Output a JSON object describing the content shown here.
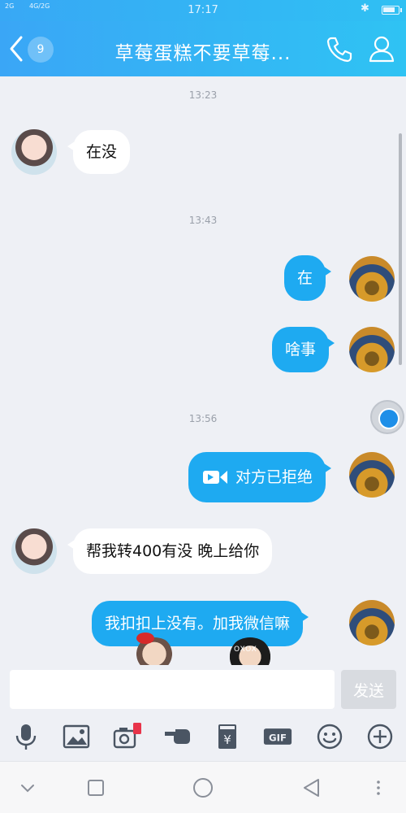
{
  "status_bar": {
    "signal_1": "2G",
    "signal_2": "4G/2G",
    "time": "17:17",
    "bluetooth_icon": "bluetooth-icon",
    "battery_icon": "battery-icon"
  },
  "header": {
    "back_icon": "chevron-left-icon",
    "unread_count": "9",
    "title": "草莓蛋糕不要草莓...",
    "phone_icon": "phone-icon",
    "profile_icon": "person-icon",
    "colors": {
      "gradient_start": "#3aa6f6",
      "gradient_end": "#2fc3f3"
    }
  },
  "chat": {
    "timestamps": [
      "13:23",
      "13:43",
      "13:56"
    ],
    "messages": [
      {
        "from": "other",
        "text": "在没"
      },
      {
        "from": "me",
        "text": "在"
      },
      {
        "from": "me",
        "text": "啥事"
      },
      {
        "from": "me",
        "type": "video-call",
        "text": "对方已拒绝"
      },
      {
        "from": "other",
        "text": "帮我转400有没 晚上给你"
      },
      {
        "from": "me",
        "text": "我扣扣上没有。加我微信嘛"
      }
    ],
    "sticker_text": "OXOX",
    "colors": {
      "outgoing_bubble": "#1eaaf1",
      "incoming_bubble": "#ffffff",
      "background": "#eef0f5"
    }
  },
  "input_bar": {
    "value": "",
    "send_label": "发送"
  },
  "toolbar": {
    "tools": [
      "microphone-icon",
      "image-icon",
      "camera-red-packet-icon",
      "poke-icon",
      "transfer-icon",
      "gif-icon",
      "emoji-icon",
      "plus-icon"
    ],
    "gif_label": "GIF",
    "yen_label": "¥"
  },
  "navbar": {
    "buttons": [
      "chevron-down-icon",
      "square-icon",
      "circle-icon",
      "triangle-back-icon",
      "more-vertical-icon"
    ]
  }
}
